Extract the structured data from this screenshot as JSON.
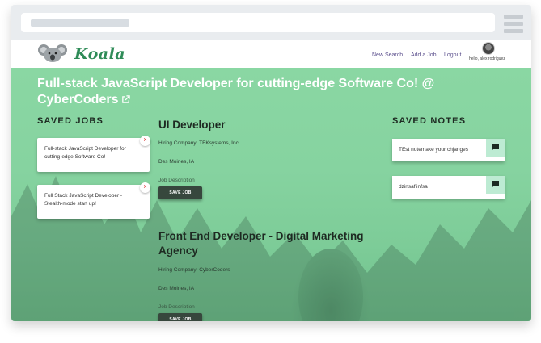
{
  "navbar": {
    "brand": "Koala",
    "links": [
      "New Search",
      "Add a Job",
      "Logout"
    ],
    "greeting": "hello, alex rodriguez"
  },
  "page": {
    "title": "Full-stack JavaScript Developer for cutting-edge Software Co! @ CyberCoders"
  },
  "saved_jobs": {
    "heading": "SAVED JOBS",
    "items": [
      {
        "label": "Full-stack JavaScript Developer for cutting-edge Software Co!"
      },
      {
        "label": "Full Stack JavaScript Developer - Stealth-mode start up!"
      }
    ],
    "close_symbol": "x"
  },
  "jobs": [
    {
      "title": "UI Developer",
      "company": "Hiring Company: TEKsystems, Inc.",
      "location": "Des Moines, IA",
      "desc_link": "Job Description",
      "save_label": "SAVE JOB"
    },
    {
      "title": "Front End Developer - Digital Marketing Agency",
      "company": "Hiring Company: CyberCoders",
      "location": "Des Moines, IA",
      "desc_link": "Job Description",
      "save_label": "SAVE JOB"
    }
  ],
  "saved_notes": {
    "heading": "SAVED NOTES",
    "items": [
      {
        "text": "TEst notemake your chjanges"
      },
      {
        "text": "dzinsaflinfsa"
      }
    ]
  },
  "colors": {
    "accent_green": "#2e8b57",
    "overlay_green": "#86d3a0",
    "nav_link": "#5a4e8c",
    "button_dark": "#37473d"
  },
  "icons": [
    "koala-logo-icon",
    "external-link-icon",
    "close-icon",
    "comment-icon",
    "hamburger-menu-icon",
    "avatar"
  ]
}
